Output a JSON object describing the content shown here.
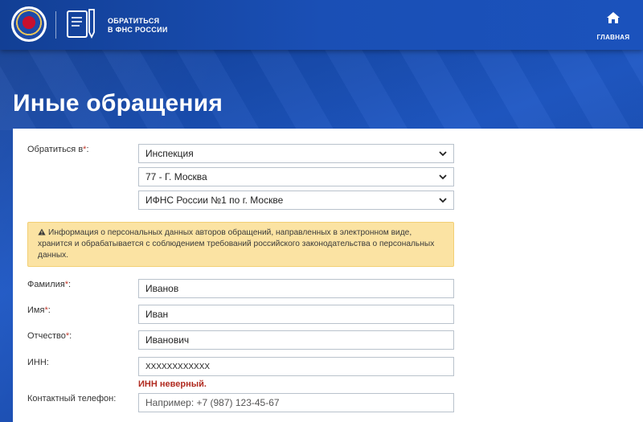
{
  "header": {
    "brand_line1": "ОБРАТИТЬСЯ",
    "brand_line2": "В ФНС РОССИИ",
    "home_label": "ГЛАВНАЯ"
  },
  "page": {
    "title": "Иные обращения"
  },
  "form": {
    "recipient": {
      "label": "Обратиться в",
      "required_mark": "*",
      "label_suffix": ":",
      "type_value": "Инспекция",
      "region_value": "77 - Г. Москва",
      "inspection_value": "ИФНС России №1 по г. Москве"
    },
    "notice": "Информация о персональных данных авторов обращений, направленных в электронном виде, хранится и обрабатывается с соблюдением требований российского законодательства о персональных данных.",
    "surname": {
      "label": "Фамилия",
      "required_mark": "*",
      "label_suffix": ":",
      "value": "Иванов"
    },
    "name": {
      "label": "Имя",
      "required_mark": "*",
      "label_suffix": ":",
      "value": "Иван"
    },
    "patronymic": {
      "label": "Отчество",
      "required_mark": "*",
      "label_suffix": ":",
      "value": "Иванович"
    },
    "inn": {
      "label": "ИНН:",
      "value": "XXXXXXXXXXXX",
      "error": "ИНН неверный."
    },
    "phone": {
      "label": "Контактный телефон:",
      "placeholder": "Например: +7 (987) 123-45-67"
    }
  },
  "colors": {
    "header_blue": "#1a4fb5",
    "required_red": "#c0392b",
    "error_red": "#b02a1f",
    "alert_bg": "#fbe3a3"
  }
}
